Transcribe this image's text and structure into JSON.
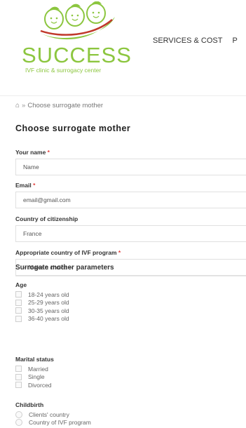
{
  "header": {
    "logo_word": "SUCCESS",
    "logo_sub": "IVF clinic  & surrogacy center",
    "nav": [
      "SERVICES & COST",
      "P"
    ]
  },
  "breadcrumb": {
    "home_icon": "home-icon",
    "separator": "»",
    "current": "Choose surrogate mother"
  },
  "page_title": "Choose surrogate mother",
  "form": {
    "name": {
      "label": "Your name",
      "required": "*",
      "placeholder": "Name"
    },
    "email": {
      "label": "Email",
      "required": "*",
      "placeholder": "email@gmail.com"
    },
    "citizenship": {
      "label": "Country of citizenship",
      "value": "France"
    },
    "ivf_country": {
      "label": "Appropriate country of IVF program",
      "required": "*",
      "value": "-- Make a choice --"
    }
  },
  "parameters": {
    "title": "Surrogate mother parameters",
    "age": {
      "label": "Age",
      "options": [
        "18-24 years old",
        "25-29 years old",
        "30-35 years old",
        "36-40 years old"
      ]
    },
    "marital": {
      "label": "Marital status",
      "options": [
        "Married",
        "Single",
        "Divorced"
      ]
    },
    "childbirth": {
      "label": "Childbirth",
      "options": [
        "Clients' country",
        "Country of IVF program"
      ]
    }
  },
  "colors": {
    "brand_green": "#8cc63f",
    "required_red": "#e2403d"
  }
}
